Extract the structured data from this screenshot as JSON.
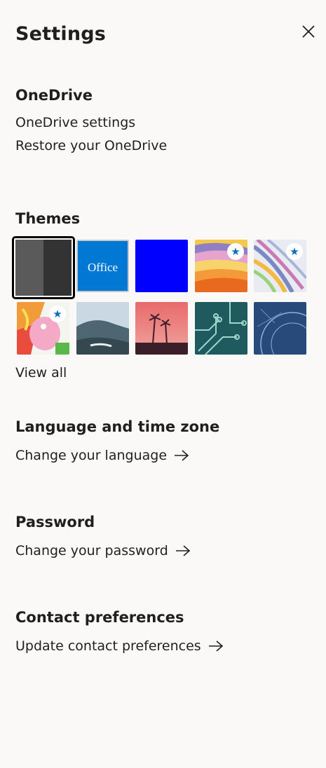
{
  "panel": {
    "title": "Settings",
    "close_icon": "close-icon"
  },
  "onedrive": {
    "heading": "OneDrive",
    "settings_link": "OneDrive settings",
    "restore_link": "Restore your OneDrive"
  },
  "themes": {
    "heading": "Themes",
    "view_all": "View all",
    "office_label": "Office",
    "items": [
      {
        "name": "dark-gray",
        "selected": true,
        "starred": false
      },
      {
        "name": "office",
        "selected": false,
        "starred": false
      },
      {
        "name": "blue",
        "selected": false,
        "starred": false
      },
      {
        "name": "rainbow-stripes",
        "selected": false,
        "starred": true
      },
      {
        "name": "ribbon-swirl",
        "selected": false,
        "starred": true
      },
      {
        "name": "cartoon-character",
        "selected": false,
        "starred": true
      },
      {
        "name": "mountain-landscape",
        "selected": false,
        "starred": false
      },
      {
        "name": "palm-trees-sunset",
        "selected": false,
        "starred": false
      },
      {
        "name": "circuit-board",
        "selected": false,
        "starred": false
      },
      {
        "name": "innovation-blueprint",
        "selected": false,
        "starred": false
      }
    ],
    "star_glyph": "★"
  },
  "language": {
    "heading": "Language and time zone",
    "link": "Change your language"
  },
  "password": {
    "heading": "Password",
    "link": "Change your password"
  },
  "contact": {
    "heading": "Contact preferences",
    "link": "Update contact preferences"
  },
  "colors": {
    "background": "#faf9f8",
    "text": "#201f1e",
    "office_blue": "#0078d4",
    "blue_theme": "#0000ff",
    "star_blue": "#0f6cbd"
  }
}
